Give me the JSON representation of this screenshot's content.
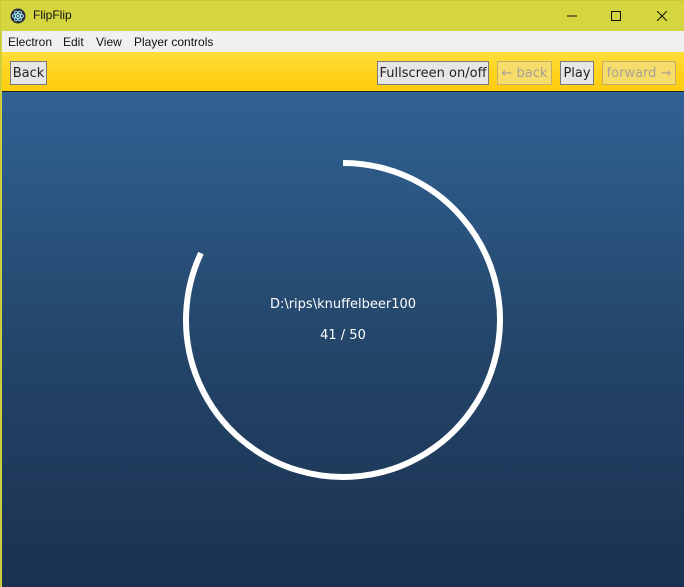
{
  "window": {
    "title": "FlipFlip",
    "icon": "electron-atom-icon"
  },
  "menu": {
    "items": [
      "Electron",
      "Edit",
      "View",
      "Player controls"
    ]
  },
  "toolbar": {
    "back_label": "Back",
    "fullscreen_label": "Fullscreen on/off",
    "history_back_label": "← back",
    "play_label": "Play",
    "forward_label": "forward →"
  },
  "loader": {
    "path": "D:\\rips\\knuffelbeer100",
    "counter": "41 / 50",
    "progress": 0.82
  },
  "colors": {
    "titlebar": "#d4d53f",
    "toolbar": "#ffd21a",
    "stage_top": "#306294",
    "stage_bottom": "#1b3150",
    "ring": "#ffffff"
  }
}
